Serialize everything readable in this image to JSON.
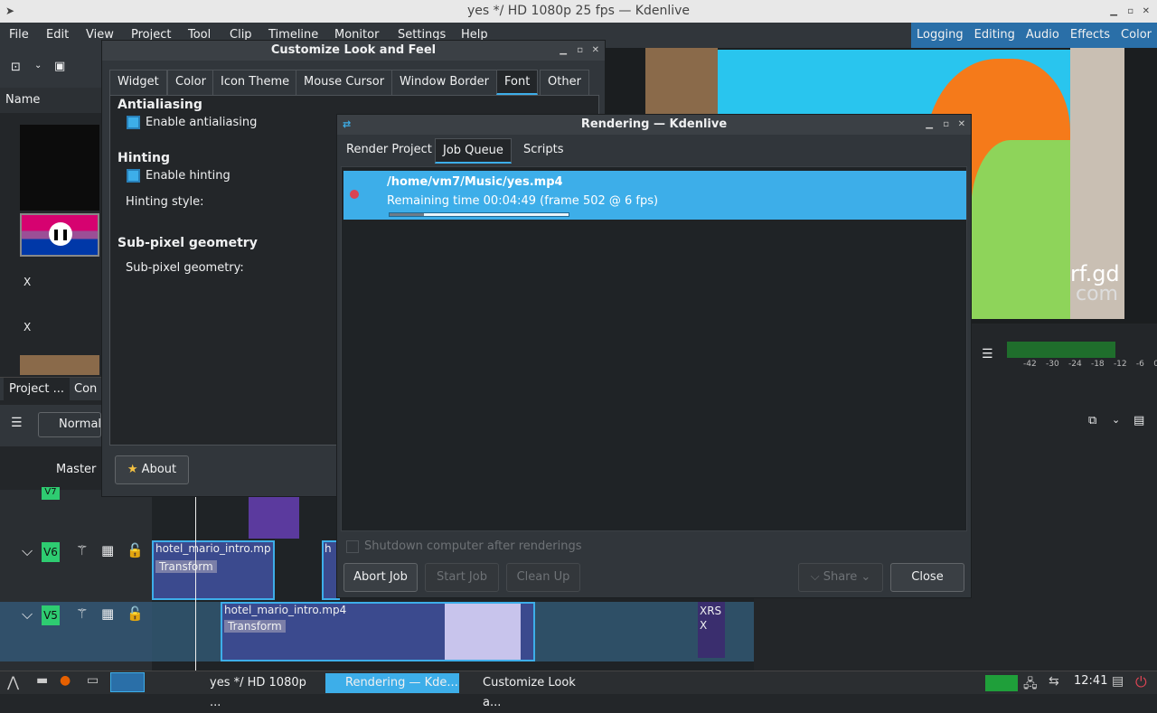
{
  "window": {
    "title": "yes */ HD 1080p 25 fps — Kdenlive"
  },
  "menu": [
    "File",
    "Edit",
    "View",
    "Project",
    "Tool",
    "Clip",
    "Timeline",
    "Monitor",
    "Settings",
    "Help"
  ],
  "layouts": [
    "Logging",
    "Editing",
    "Audio",
    "Effects",
    "Color"
  ],
  "bin": {
    "column_name": "Name",
    "items": [
      "X",
      "X"
    ],
    "tabs": [
      "Project ...",
      "Con"
    ]
  },
  "mixer": {
    "mode_label": "Normal",
    "master_label": "Master"
  },
  "tracks": [
    {
      "name": "V7"
    },
    {
      "name": "V6",
      "clips": [
        {
          "label": "hotel_mario_intro.mp",
          "effect": "Transform"
        },
        {
          "label": "h"
        }
      ]
    },
    {
      "name": "V5",
      "clips": [
        {
          "label": "hotel_mario_intro.mp4",
          "effect": "Transform"
        },
        {
          "label": "XRS X"
        }
      ]
    }
  ],
  "monitor": {
    "watermark": "rf.gd",
    "watermark2": "com"
  },
  "audio_meter": {
    "ticks": [
      "-42",
      "-30",
      "-24",
      "-18",
      "-12",
      "-6",
      "0"
    ]
  },
  "look_feel": {
    "title": "Customize Look and Feel",
    "tabs": [
      "Widget",
      "Color",
      "Icon Theme",
      "Mouse Cursor",
      "Window Border",
      "Font",
      "Other"
    ],
    "active_tab": "Font",
    "antialiasing_heading": "Antialiasing",
    "enable_antialiasing": "Enable antialiasing",
    "hinting_heading": "Hinting",
    "enable_hinting": "Enable hinting",
    "hinting_style": "Hinting style:",
    "subpixel_heading": "Sub-pixel geometry",
    "subpixel_label": "Sub-pixel geometry:",
    "about": "About"
  },
  "render": {
    "title": "Rendering — Kdenlive",
    "tabs": [
      "Render Project",
      "Job Queue",
      "Scripts"
    ],
    "active_tab": "Job Queue",
    "job": {
      "path": "/home/vm7/Music/yes.mp4",
      "status": "Remaining time 00:04:49 (frame 502 @ 6 fps)",
      "progress": 0.19
    },
    "shutdown": "Shutdown computer after renderings",
    "abort": "Abort Job",
    "start": "Start Job",
    "cleanup": "Clean Up",
    "share": "Share",
    "close": "Close"
  },
  "taskbar": {
    "tasks": [
      "yes */ HD 1080p ...",
      "Rendering — Kde...",
      "Customize Look a..."
    ],
    "clock": "12:41"
  },
  "colors": {
    "accent": "#3daee9",
    "selection": "#3daee9",
    "record": "#da4453",
    "track_label": "#2ecc71"
  }
}
